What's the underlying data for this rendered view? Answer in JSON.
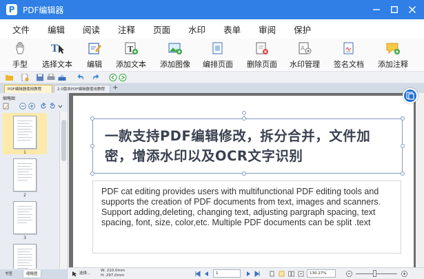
{
  "window": {
    "logo_glyph": "P",
    "title": "PDF编辑器",
    "controls": [
      {
        "name": "minimize-icon"
      },
      {
        "name": "maximize-icon"
      },
      {
        "name": "close-icon"
      }
    ]
  },
  "menu": [
    "文件",
    "编辑",
    "阅读",
    "注释",
    "页面",
    "水印",
    "表单",
    "审阅",
    "保护"
  ],
  "toolbar": [
    {
      "label": "手型",
      "icon": "hand-icon"
    },
    {
      "label": "选择文本",
      "icon": "select-text-icon"
    },
    {
      "label": "编辑",
      "icon": "edit-icon"
    },
    {
      "label": "添加文本",
      "icon": "add-text-icon"
    },
    {
      "label": "添加图像",
      "icon": "add-image-icon"
    },
    {
      "label": "编排页面",
      "icon": "arrange-pages-icon"
    },
    {
      "label": "删除页面",
      "icon": "delete-page-icon"
    },
    {
      "label": "水印管理",
      "icon": "watermark-icon"
    },
    {
      "label": "签名文档",
      "icon": "sign-document-icon"
    },
    {
      "label": "添加注释",
      "icon": "add-comment-icon"
    }
  ],
  "quick_tools": [
    "open-folder-icon",
    "new-file-icon",
    "save-icon",
    "print-icon",
    "scan-icon",
    "undo-icon",
    "redo-icon",
    "back-icon",
    "forward-icon"
  ],
  "tabs": [
    {
      "label": "PDF编辑器使用教程",
      "active": true
    },
    {
      "label": "2.0版本PDF编辑器使用教程",
      "active": false
    }
  ],
  "thumbnails": {
    "title": "缩略图",
    "pages": [
      "1",
      "2",
      "3",
      ""
    ],
    "bottom_tabs": [
      "书签",
      "缩略图"
    ]
  },
  "document": {
    "title": "一款支持PDF编辑修改，拆分合并，文件加密，增添水印以及OCR文字识别",
    "body": "PDF cat editing provides users with multifunctional PDF editing tools and supports the creation of PDF documents from text, images and scanners. Support adding,deleting, changing text, adjusting pargraph spacing, text spacing, font, size, color,etc. Multiple PDF documents can be split .text"
  },
  "status": {
    "select_label": "选择...",
    "width_text": "W: 210.0mm",
    "height_text": "H: 297.0mm",
    "page_value": "1",
    "zoom": "130.27%"
  },
  "colors": {
    "accent": "#2f7fe6",
    "title_text": "#3a4150"
  }
}
